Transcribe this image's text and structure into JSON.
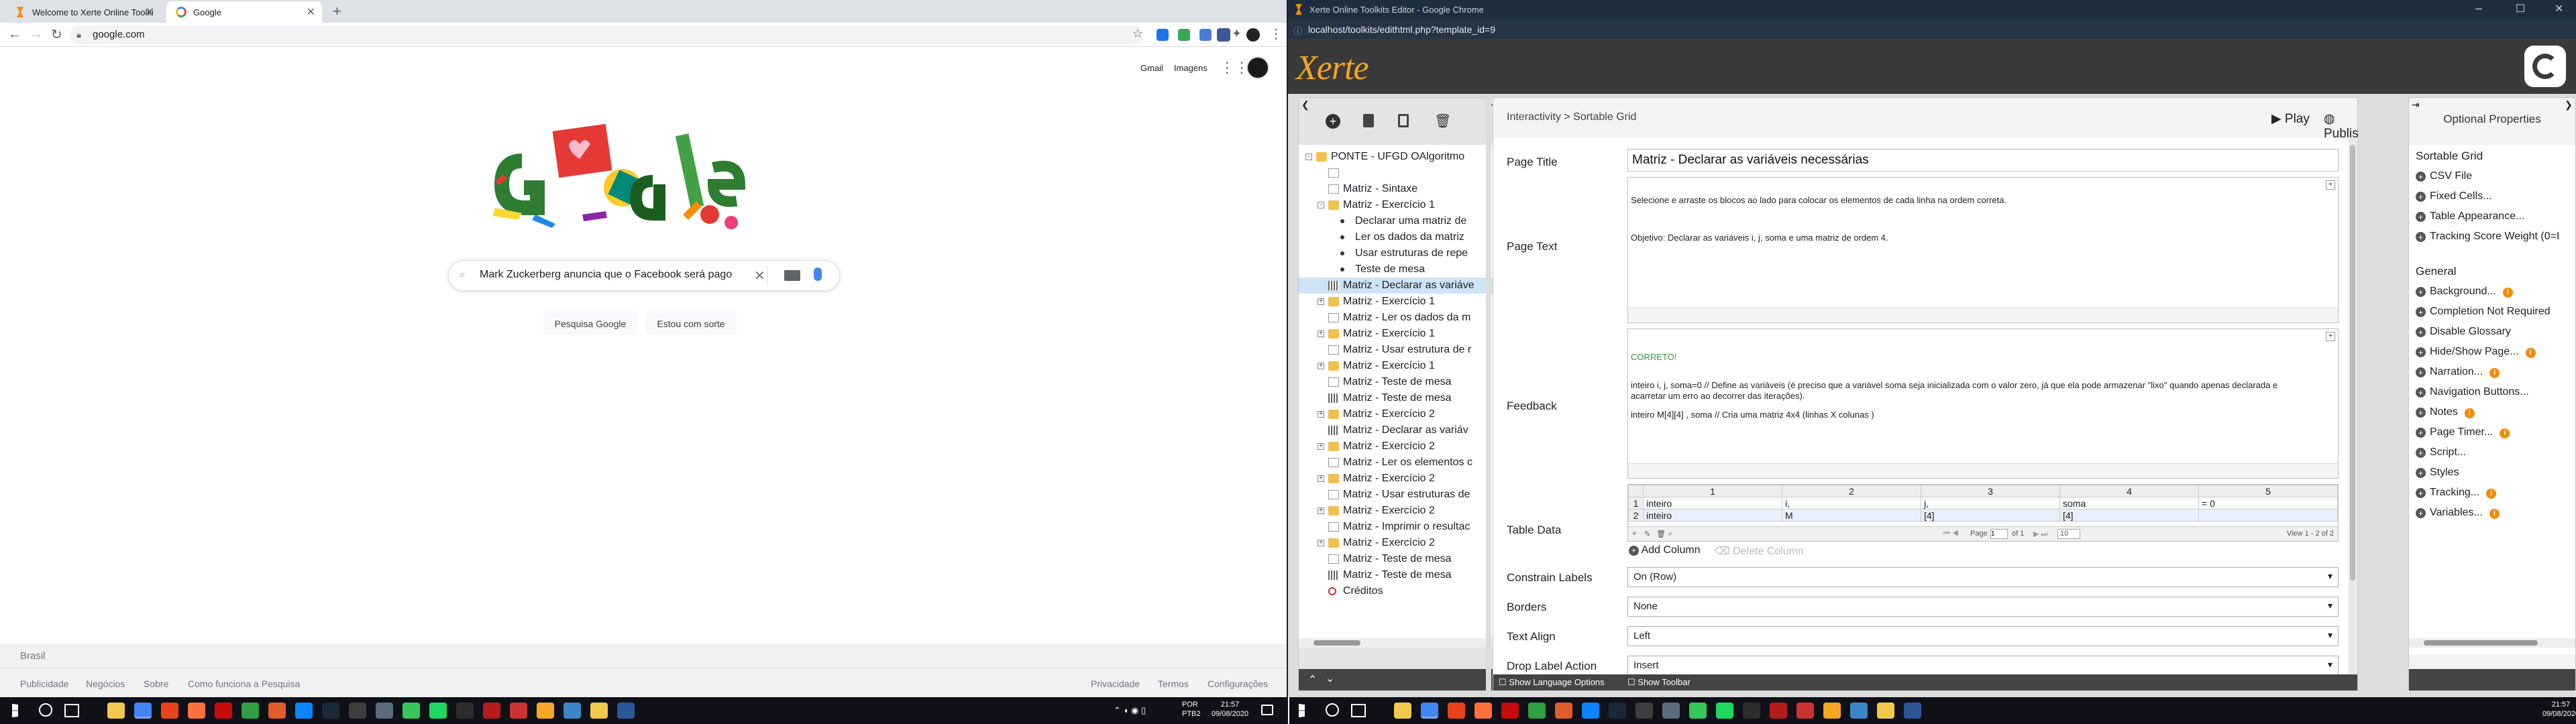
{
  "left_browser": {
    "tabs": [
      {
        "title": "Welcome to Xerte Online Toolki"
      },
      {
        "title": "Google"
      }
    ],
    "new_tab": "+",
    "url": "google.com",
    "header_links": [
      "Gmail",
      "Imagens"
    ],
    "search_value": "Mark Zuckerberg anuncia que o Facebook será pago",
    "search_buttons": [
      "Pesquisa Google",
      "Estou com sorte"
    ],
    "footer_country": "Brasil",
    "footer_left_links": [
      "Publicidade",
      "Negócios",
      "Sobre",
      "Como funciona a Pesquisa"
    ],
    "footer_right_links": [
      "Privacidade",
      "Termos",
      "Configurações"
    ]
  },
  "right_browser": {
    "title": "Xerte Online Toolkits Editor - Google Chrome",
    "url": "localhost/toolkits/edithtml.php?template_id=9",
    "logo": "Xerte"
  },
  "xerte": {
    "breadcrumb": "Interactivity > Sortable Grid",
    "play_label": "Play",
    "publish_label": "Publish",
    "optional_title": "Optional Properties",
    "tree": [
      {
        "label": "PONTE - UFGD OAlgoritmo",
        "lvl": 0,
        "tg": "-",
        "icon": "folder"
      },
      {
        "label": "",
        "lvl": 1,
        "tg": "",
        "icon": "page"
      },
      {
        "label": "Matriz - Sintaxe",
        "lvl": 1,
        "tg": "",
        "icon": "page"
      },
      {
        "label": "Matriz - Exercício 1",
        "lvl": 1,
        "tg": "-",
        "icon": "folder"
      },
      {
        "label": "Declarar uma matriz de",
        "lvl": 2,
        "tg": "",
        "icon": "bullet"
      },
      {
        "label": "Ler os dados da matriz",
        "lvl": 2,
        "tg": "",
        "icon": "bullet"
      },
      {
        "label": "Usar estruturas de repe",
        "lvl": 2,
        "tg": "",
        "icon": "bullet"
      },
      {
        "label": "Teste de mesa",
        "lvl": 2,
        "tg": "",
        "icon": "bullet"
      },
      {
        "label": "Matriz - Declarar as variáve",
        "lvl": 1,
        "tg": "",
        "icon": "grid",
        "selected": true
      },
      {
        "label": "Matriz - Exercício 1",
        "lvl": 1,
        "tg": "+",
        "icon": "folder"
      },
      {
        "label": "Matriz - Ler os dados da m",
        "lvl": 1,
        "tg": "",
        "icon": "page"
      },
      {
        "label": "Matriz - Exercício 1",
        "lvl": 1,
        "tg": "+",
        "icon": "folder"
      },
      {
        "label": "Matriz - Usar estrutura de r",
        "lvl": 1,
        "tg": "",
        "icon": "page"
      },
      {
        "label": "Matriz - Exercício 1",
        "lvl": 1,
        "tg": "+",
        "icon": "folder"
      },
      {
        "label": "Matriz - Teste de mesa",
        "lvl": 1,
        "tg": "",
        "icon": "page"
      },
      {
        "label": "Matriz - Teste de mesa",
        "lvl": 1,
        "tg": "",
        "icon": "grid"
      },
      {
        "label": "Matriz - Exercício 2",
        "lvl": 1,
        "tg": "+",
        "icon": "folder"
      },
      {
        "label": "Matriz - Declarar as variáv",
        "lvl": 1,
        "tg": "",
        "icon": "grid"
      },
      {
        "label": "Matriz - Exercício 2",
        "lvl": 1,
        "tg": "+",
        "icon": "folder"
      },
      {
        "label": "Matriz - Ler os elementos c",
        "lvl": 1,
        "tg": "",
        "icon": "page"
      },
      {
        "label": "Matriz - Exercício 2",
        "lvl": 1,
        "tg": "+",
        "icon": "folder"
      },
      {
        "label": "Matriz - Usar estruturas de",
        "lvl": 1,
        "tg": "",
        "icon": "page"
      },
      {
        "label": "Matriz - Exercício 2",
        "lvl": 1,
        "tg": "+",
        "icon": "folder"
      },
      {
        "label": "Matriz - Imprimir o resultac",
        "lvl": 1,
        "tg": "",
        "icon": "page"
      },
      {
        "label": "Matriz - Exercício 2",
        "lvl": 1,
        "tg": "+",
        "icon": "folder"
      },
      {
        "label": "Matriz - Teste de mesa",
        "lvl": 1,
        "tg": "",
        "icon": "page"
      },
      {
        "label": "Matriz - Teste de mesa",
        "lvl": 1,
        "tg": "",
        "icon": "grid"
      },
      {
        "label": "Créditos",
        "lvl": 1,
        "tg": "",
        "icon": "credit"
      }
    ],
    "labels": {
      "page_title": "Page Title",
      "page_text": "Page Text",
      "feedback": "Feedback",
      "table_data": "Table Data",
      "constrain": "Constrain Labels",
      "borders": "Borders",
      "text_align": "Text Align",
      "drop_label": "Drop Label Action"
    },
    "page_title_value": "Matriz - Declarar as variáveis necessárias",
    "page_text_lines": [
      "Selecione e arraste os blocos ao lado para colocar os elementos de cada linha na ordem correta.",
      "Objetivo: Declarar as variáveis i, j, soma e uma matriz de ordem 4."
    ],
    "feedback_correct": "CORRETO!",
    "feedback_lines": [
      "inteiro i, j, soma=0 // Define as variáveis (é preciso que a variável soma seja inicializada com o valor zero, já que ela pode armazenar \"lixo\" quando apenas declarada e",
      "acarretar um erro ao decorrer das iterações).",
      "inteiro M[4][4] , soma // Cria uma matriz 4x4 (linhas X colunas )"
    ],
    "table": {
      "headers": [
        "1",
        "2",
        "3",
        "4",
        "5"
      ],
      "rows": [
        [
          "1",
          "inteiro",
          "i,",
          "j,",
          "soma",
          "= 0"
        ],
        [
          "2",
          "inteiro",
          "M",
          "[4]",
          "[4]",
          ""
        ]
      ],
      "pager_page": "Page",
      "pager_value": "1",
      "pager_of": "of 1",
      "pager_size": "10",
      "view_text": "View 1 - 2 of 2"
    },
    "add_column": "Add Column",
    "delete_column": "Delete Column",
    "constrain_value": "On (Row)",
    "borders_value": "None",
    "text_align_value": "Left",
    "drop_value": "Insert",
    "show_language": "Show Language Options",
    "show_toolbar": "Show Toolbar",
    "optional": {
      "sortable_header": "Sortable Grid",
      "sortable_items": [
        {
          "label": "CSV File",
          "info": false
        },
        {
          "label": "Fixed Cells...",
          "info": false
        },
        {
          "label": "Table Appearance...",
          "info": false
        },
        {
          "label": "Tracking Score Weight (0=I",
          "info": false
        }
      ],
      "general_header": "General",
      "general_items": [
        {
          "label": "Background...",
          "info": true
        },
        {
          "label": "Completion Not Required",
          "info": false
        },
        {
          "label": "Disable Glossary",
          "info": false
        },
        {
          "label": "Hide/Show Page...",
          "info": true
        },
        {
          "label": "Narration...",
          "info": true
        },
        {
          "label": "Navigation Buttons...",
          "info": false
        },
        {
          "label": "Notes",
          "info": true
        },
        {
          "label": "Page Timer...",
          "info": true
        },
        {
          "label": "Script...",
          "info": false
        },
        {
          "label": "Styles",
          "info": false
        },
        {
          "label": "Tracking...",
          "info": true
        },
        {
          "label": "Variables...",
          "info": true
        }
      ]
    }
  },
  "taskbar_left": {
    "lang": "POR",
    "layout": "PTB2",
    "time": "21:57",
    "date": "09/08/2020"
  },
  "taskbar_right": {
    "time": "21:57",
    "date": "09/08/2020"
  }
}
